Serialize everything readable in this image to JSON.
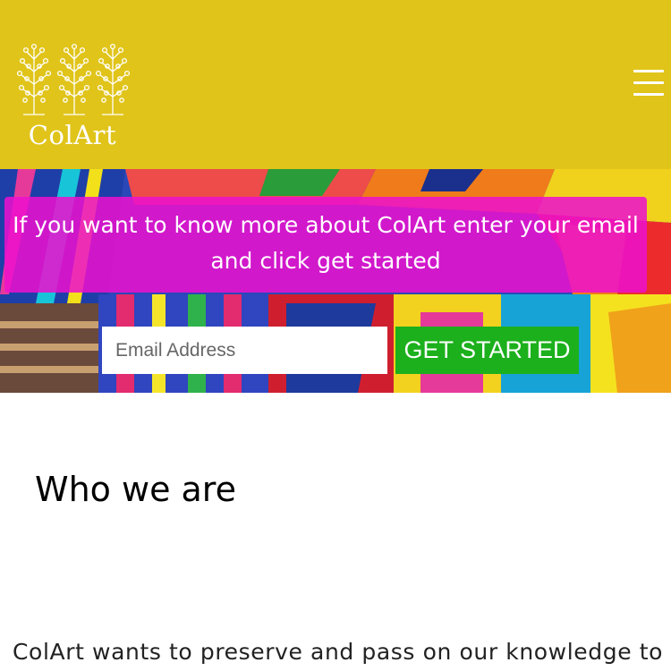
{
  "header": {
    "logo_text": "ColArt",
    "background": "#e0c41a",
    "menu_icon": "hamburger-menu-icon"
  },
  "hero": {
    "banner_text": "If you want to know more about ColArt enter your email and click get started",
    "banner_color": "#ec10ce",
    "email_placeholder": "Email Address",
    "cta_label": "GET STARTED",
    "cta_color": "#1cb01c"
  },
  "about": {
    "title": "Who we are",
    "intro": "ColArt wants to preserve and pass on our knowledge to"
  }
}
